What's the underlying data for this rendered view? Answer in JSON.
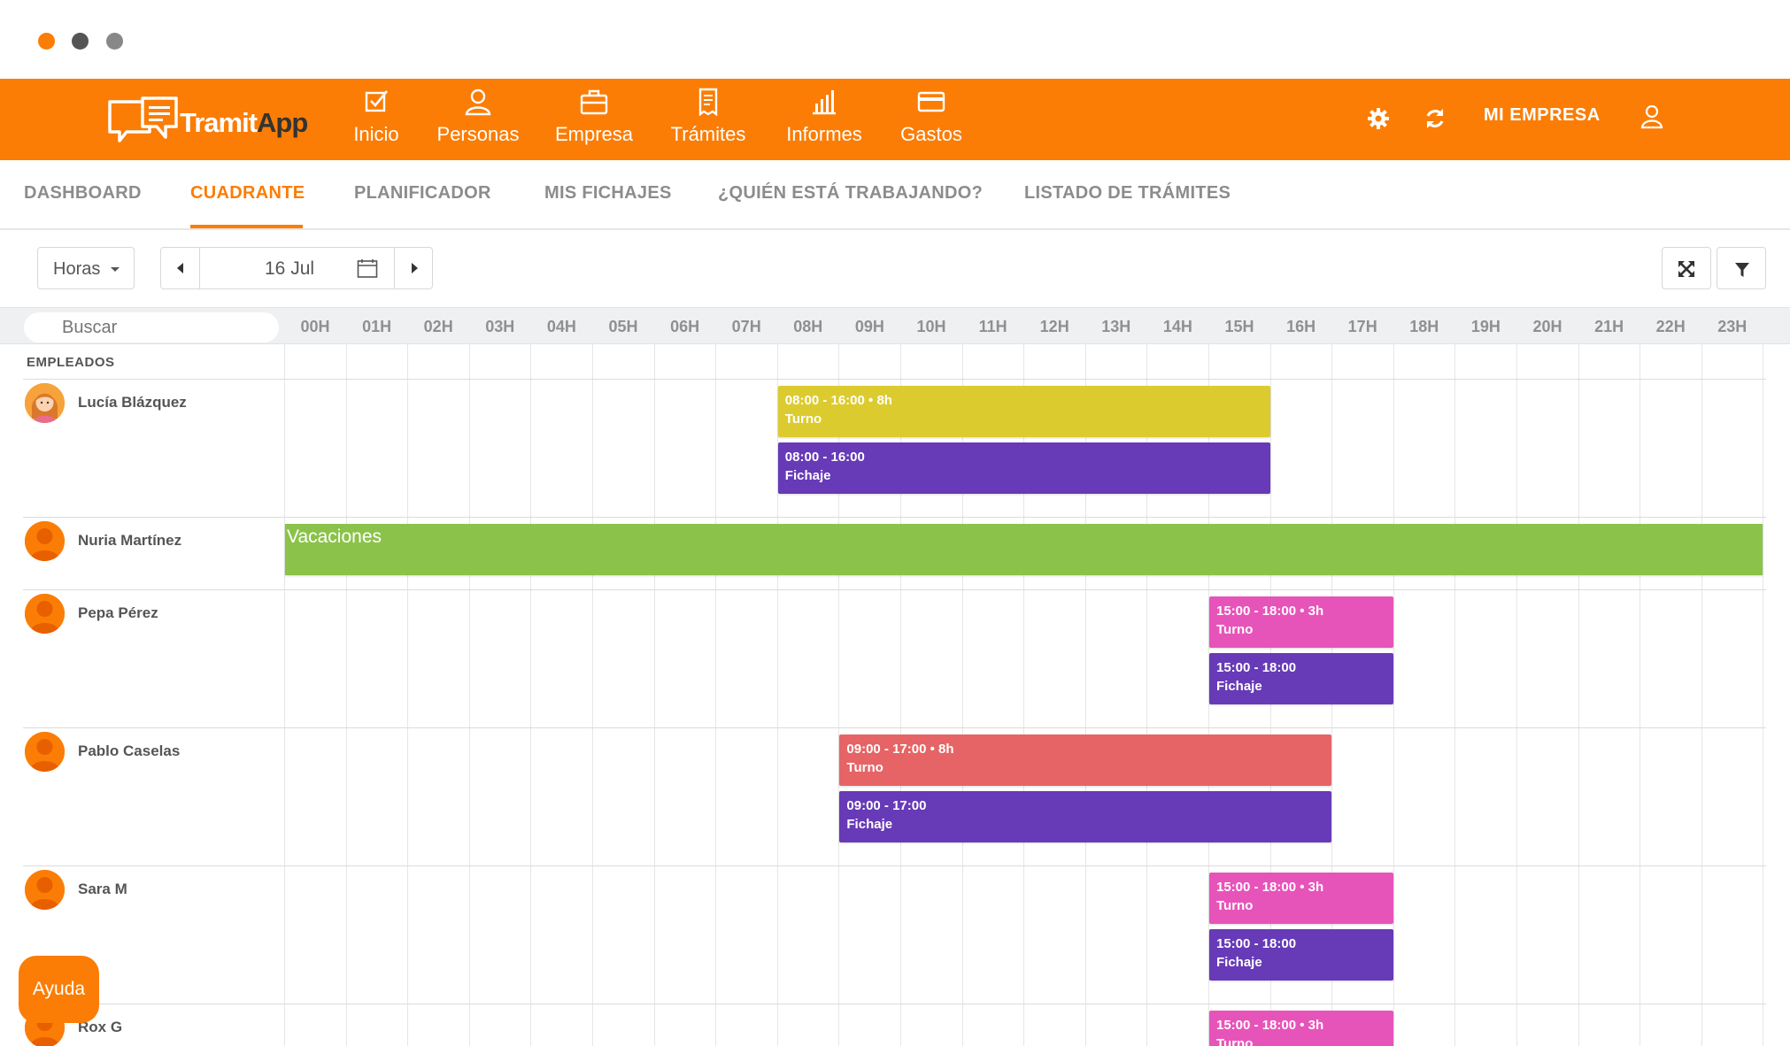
{
  "brand": {
    "name_part1": "Tramit",
    "name_part2": "App"
  },
  "nav": [
    {
      "label": "Inicio",
      "icon": "checkbox-icon"
    },
    {
      "label": "Personas",
      "icon": "person-icon"
    },
    {
      "label": "Empresa",
      "icon": "briefcase-icon"
    },
    {
      "label": "Trámites",
      "icon": "receipt-icon"
    },
    {
      "label": "Informes",
      "icon": "bar-chart-icon"
    },
    {
      "label": "Gastos",
      "icon": "credit-card-icon"
    }
  ],
  "topbar": {
    "company_label": "MI EMPRESA"
  },
  "subtabs": [
    "DASHBOARD",
    "CUADRANTE",
    "PLANIFICADOR",
    "MIS FICHAJES",
    "¿QUIÉN ESTÁ TRABAJANDO?",
    "LISTADO DE TRÁMITES"
  ],
  "active_subtab": "CUADRANTE",
  "toolbar": {
    "view_select": "Horas",
    "date": "16 Jul"
  },
  "search": {
    "placeholder": "Buscar"
  },
  "hours": [
    "00H",
    "01H",
    "02H",
    "03H",
    "04H",
    "05H",
    "06H",
    "07H",
    "08H",
    "09H",
    "10H",
    "11H",
    "12H",
    "13H",
    "14H",
    "15H",
    "16H",
    "17H",
    "18H",
    "19H",
    "20H",
    "21H",
    "22H",
    "23H"
  ],
  "section_label": "EMPLEADOS",
  "employees": [
    {
      "name": "Lucía Blázquez",
      "avatar": "female-avatar"
    },
    {
      "name": "Nuria Martínez",
      "avatar": "default-avatar"
    },
    {
      "name": "Pepa Pérez",
      "avatar": "default-avatar"
    },
    {
      "name": "Pablo Caselas",
      "avatar": "default-avatar"
    },
    {
      "name": "Sara M",
      "avatar": "default-avatar"
    },
    {
      "name": "Rox G",
      "avatar": "default-avatar"
    }
  ],
  "shifts": [
    {
      "employee": 0,
      "line1": "08:00 - 16:00 • 8h",
      "line2": "Turno",
      "start": 8,
      "end": 16,
      "slot": 0,
      "color": "#dccb2f"
    },
    {
      "employee": 0,
      "line1": "08:00 - 16:00",
      "line2": "Fichaje",
      "start": 8,
      "end": 16,
      "slot": 1,
      "color": "#673ab7"
    },
    {
      "employee": 1,
      "line1": "Vacaciones",
      "line2": "",
      "start": 0,
      "end": 24,
      "slot": 0,
      "color": "#8bc34a"
    },
    {
      "employee": 2,
      "line1": "15:00 - 18:00 • 3h",
      "line2": "Turno",
      "start": 15,
      "end": 18,
      "slot": 0,
      "color": "#e754b9"
    },
    {
      "employee": 2,
      "line1": "15:00 - 18:00",
      "line2": "Fichaje",
      "start": 15,
      "end": 18,
      "slot": 1,
      "color": "#673ab7"
    },
    {
      "employee": 3,
      "line1": "09:00 - 17:00 • 8h",
      "line2": "Turno",
      "start": 9,
      "end": 17,
      "slot": 0,
      "color": "#e66465"
    },
    {
      "employee": 3,
      "line1": "09:00 - 17:00",
      "line2": "Fichaje",
      "start": 9,
      "end": 17,
      "slot": 1,
      "color": "#673ab7"
    },
    {
      "employee": 4,
      "line1": "15:00 - 18:00 • 3h",
      "line2": "Turno",
      "start": 15,
      "end": 18,
      "slot": 0,
      "color": "#e754b9"
    },
    {
      "employee": 4,
      "line1": "15:00 - 18:00",
      "line2": "Fichaje",
      "start": 15,
      "end": 18,
      "slot": 1,
      "color": "#673ab7"
    },
    {
      "employee": 5,
      "line1": "15:00 - 18:00 • 3h",
      "line2": "Turno",
      "start": 15,
      "end": 18,
      "slot": 0,
      "color": "#e754b9"
    }
  ],
  "help": {
    "label": "Ayuda"
  },
  "colors": {
    "accent": "#fb7d05",
    "window_dot_1": "#fb7d05",
    "window_dot_2": "#555555",
    "window_dot_3": "#888888"
  }
}
